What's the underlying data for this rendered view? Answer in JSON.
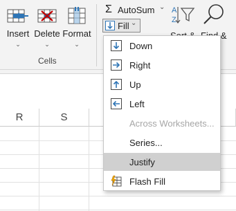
{
  "ribbon": {
    "cells_group": {
      "insert_label": "Insert",
      "delete_label": "Delete",
      "format_label": "Format",
      "chevron": "⌄",
      "group_label": "Cells"
    },
    "editing": {
      "autosum_symbol": "Σ",
      "autosum_label": "AutoSum",
      "autosum_chevron": "⌄",
      "fill_label": "Fill",
      "fill_chevron": "⌄",
      "sort_partial": "Sort &",
      "find_partial": "Find &"
    }
  },
  "columns": [
    "R",
    "S"
  ],
  "fill_menu": {
    "items": [
      {
        "label": "Down",
        "icon": "fill-down-icon",
        "enabled": true
      },
      {
        "label": "Right",
        "icon": "fill-right-icon",
        "enabled": true
      },
      {
        "label": "Up",
        "icon": "fill-up-icon",
        "enabled": true
      },
      {
        "label": "Left",
        "icon": "fill-left-icon",
        "enabled": true
      },
      {
        "label": "Across Worksheets...",
        "icon": "",
        "enabled": false
      },
      {
        "label": "Series...",
        "icon": "",
        "enabled": true
      },
      {
        "label": "Justify",
        "icon": "",
        "enabled": true,
        "highlighted": true
      },
      {
        "label": "Flash Fill",
        "icon": "flash-fill-icon",
        "enabled": true
      }
    ]
  },
  "colors": {
    "ribbon_bg": "#f3f3f3",
    "icon_blue": "#2e75b6",
    "delete_red": "#c00000",
    "hover_gray": "#d0d0d0",
    "disabled_text": "#a6a6a6"
  }
}
